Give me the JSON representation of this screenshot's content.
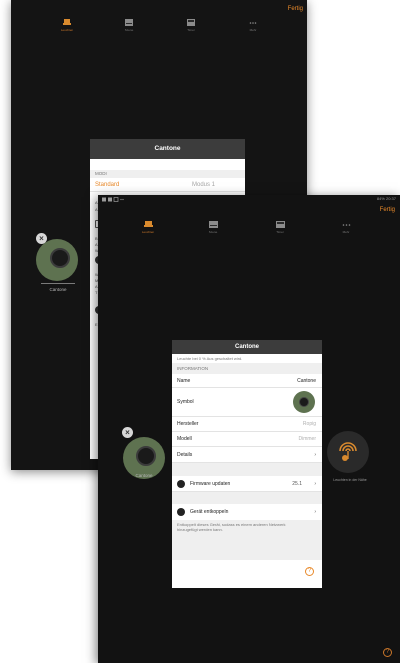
{
  "back": {
    "done_label": "Fertig",
    "nav": [
      {
        "label": "Leuchten",
        "icon": "lamp-icon",
        "active": true
      },
      {
        "label": "Szene",
        "icon": "scene-icon",
        "active": false
      },
      {
        "label": "Timer",
        "icon": "timer-icon",
        "active": false
      },
      {
        "label": "Mehr",
        "icon": "more-icon",
        "active": false
      }
    ],
    "lamp_name": "Cantone",
    "modal": {
      "title": "Cantone",
      "section_modi": "MODI",
      "mode_label": "Standard",
      "mode_value": "Modus 1",
      "edge_letters": [
        "A",
        "A",
        "Ü",
        "B",
        "A",
        "W",
        "W",
        "M",
        "A",
        "T",
        "E"
      ]
    }
  },
  "front": {
    "status_right": "84% 20:37",
    "done_label": "Fertig",
    "nav": [
      {
        "label": "Leuchten",
        "icon": "lamp-icon",
        "active": true
      },
      {
        "label": "Szene",
        "icon": "scene-icon",
        "active": false
      },
      {
        "label": "Timer",
        "icon": "timer-icon",
        "active": false
      },
      {
        "label": "Mehr",
        "icon": "more-icon",
        "active": false
      }
    ],
    "lamp_name": "Cantone",
    "nearby_label": "Leuchten in der Nähe",
    "modal": {
      "title": "Cantone",
      "top_text": "Leuchte bei 0 % Aus geschaltet wird.",
      "section_info": "INFORMATION",
      "rows": {
        "name_label": "Name",
        "name_value": "Cantone",
        "symbol_label": "Symbol",
        "manufacturer_label": "Hersteller",
        "manufacturer_value": "Ropig",
        "model_label": "Modell",
        "model_value": "Dimmer",
        "details_label": "Details"
      },
      "firmware_label": "Firmware updaten",
      "firmware_version": "25.1",
      "unpair_label": "Gerät entkoppeln",
      "unpair_note": "Entkoppelt dieses Gerät, sodass es einem anderen Netzwerk hinzugefügt werden kann."
    }
  }
}
